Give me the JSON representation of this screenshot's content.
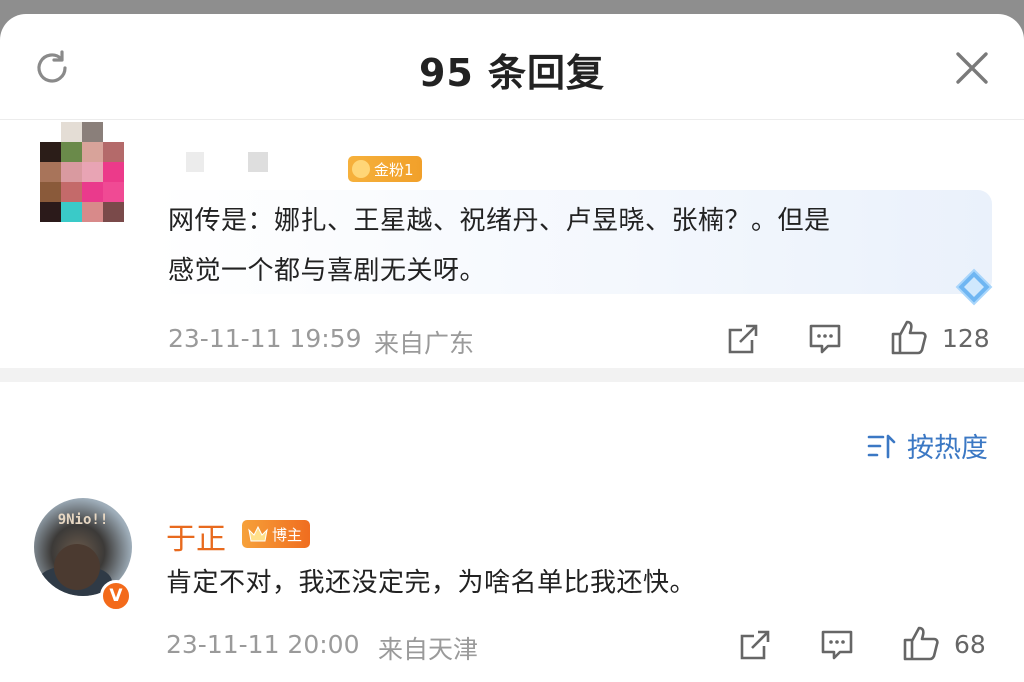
{
  "header": {
    "title": "95 条回复"
  },
  "comment1": {
    "badge_label": "金粉1",
    "text_line1": "网传是：娜扎、王星越、祝绪丹、卢昱晓、张楠？。但是",
    "text_line2": "感觉一个都与喜剧无关呀。",
    "timestamp": "23-11-11 19:59",
    "location": "来自广东",
    "like_count": "128"
  },
  "sort": {
    "label": "按热度"
  },
  "comment2": {
    "username": "于正",
    "badge_label": "博主",
    "avatar_sign": "9Nio!!",
    "verified_letter": "V",
    "text": "肯定不对，我还没定完，为啥名单比我还快。",
    "timestamp": "23-11-11 20:00",
    "location": "来自天津",
    "like_count": "68"
  },
  "colors": {
    "link_blue": "#3b78c4",
    "name_orange": "#e86a1e",
    "fan_badge": "#f1a02a",
    "verified": "#f36a1a"
  },
  "icons": {
    "refresh": "refresh-icon",
    "close": "close-icon",
    "share": "share-icon",
    "comment": "comment-icon",
    "like": "thumbs-up-icon",
    "sort": "sort-icon",
    "diamond": "diamond-icon"
  }
}
